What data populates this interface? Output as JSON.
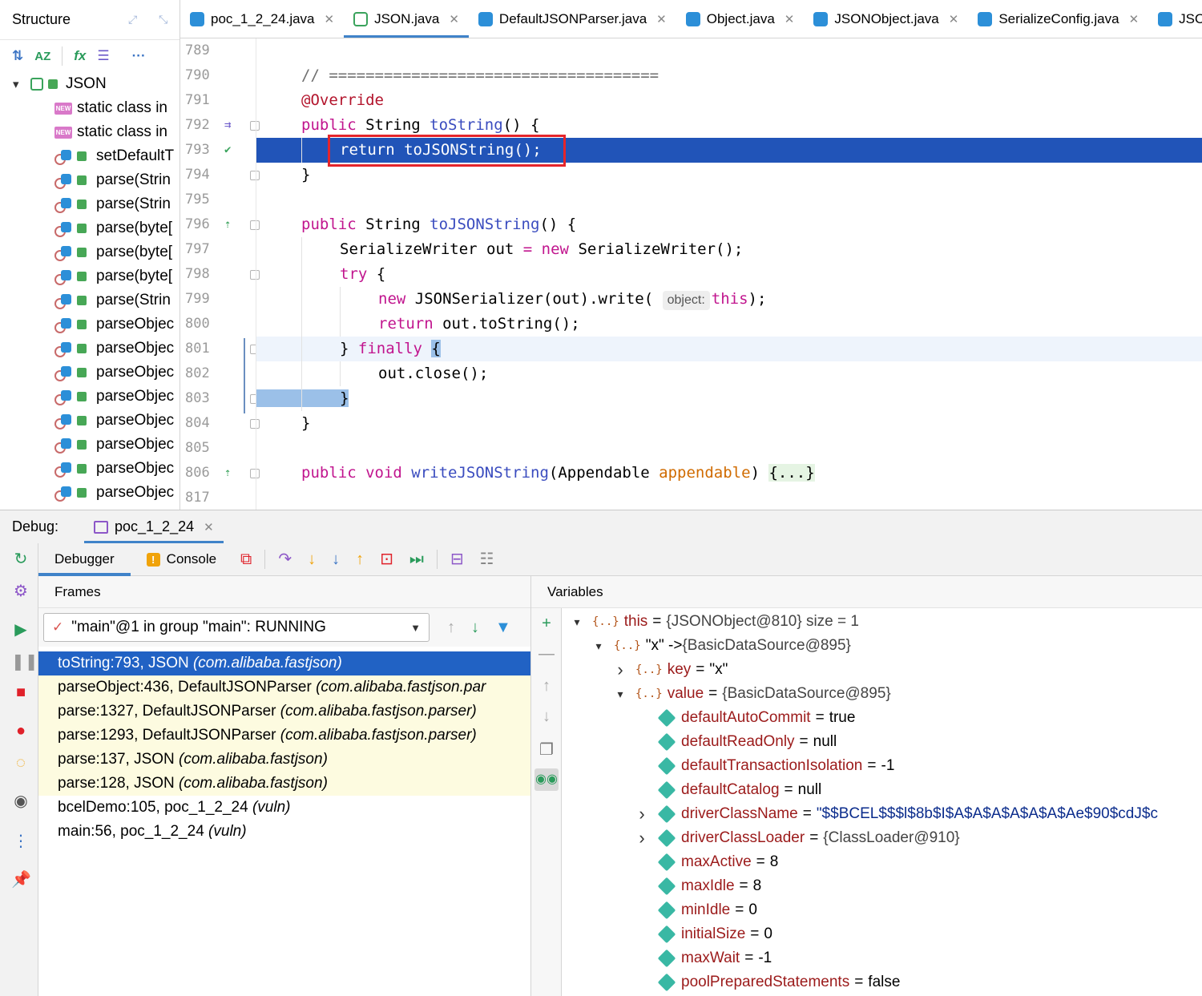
{
  "structure": {
    "title": "Structure",
    "root": "JSON",
    "items": [
      {
        "kind": "new",
        "label": "static class in"
      },
      {
        "kind": "new",
        "label": "static class in"
      },
      {
        "kind": "method",
        "label": "setDefaultT"
      },
      {
        "kind": "method",
        "label": "parse(Strin"
      },
      {
        "kind": "method",
        "label": "parse(Strin"
      },
      {
        "kind": "method",
        "label": "parse(byte["
      },
      {
        "kind": "method",
        "label": "parse(byte["
      },
      {
        "kind": "method",
        "label": "parse(byte["
      },
      {
        "kind": "method",
        "label": "parse(Strin"
      },
      {
        "kind": "method",
        "label": "parseObjec"
      },
      {
        "kind": "method",
        "label": "parseObjec"
      },
      {
        "kind": "method",
        "label": "parseObjec"
      },
      {
        "kind": "method",
        "label": "parseObjec"
      },
      {
        "kind": "method",
        "label": "parseObjec"
      },
      {
        "kind": "method",
        "label": "parseObjec"
      },
      {
        "kind": "method",
        "label": "parseObjec"
      },
      {
        "kind": "method",
        "label": "parseObjec"
      }
    ]
  },
  "tabs": [
    {
      "label": "poc_1_2_24.java",
      "icon": "class",
      "active": false
    },
    {
      "label": "JSON.java",
      "icon": "class-outline",
      "active": true
    },
    {
      "label": "DefaultJSONParser.java",
      "icon": "class",
      "active": false
    },
    {
      "label": "Object.java",
      "icon": "class",
      "active": false
    },
    {
      "label": "JSONObject.java",
      "icon": "class",
      "active": false
    },
    {
      "label": "SerializeConfig.java",
      "icon": "class",
      "active": false
    },
    {
      "label": "JSO",
      "icon": "class",
      "active": false
    }
  ],
  "editor": {
    "lines": [
      {
        "num": "789"
      },
      {
        "num": "790"
      },
      {
        "num": "791"
      },
      {
        "num": "792"
      },
      {
        "num": "793"
      },
      {
        "num": "794"
      },
      {
        "num": "795"
      },
      {
        "num": "796"
      },
      {
        "num": "797"
      },
      {
        "num": "798"
      },
      {
        "num": "799"
      },
      {
        "num": "800"
      },
      {
        "num": "801"
      },
      {
        "num": "802"
      },
      {
        "num": "803"
      },
      {
        "num": "804"
      },
      {
        "num": "805"
      },
      {
        "num": "806"
      },
      {
        "num": "817"
      }
    ],
    "code": {
      "l790_comment": "// ====================================",
      "l791_annotation": "@Override",
      "l792_kw": "public",
      "l792_type": " String ",
      "l792_fn": "toString",
      "l792_rest": "() {",
      "l793": "return toJSONString();",
      "l794": "}",
      "l796_kw": "public",
      "l796_type": " String ",
      "l796_fn": "toJSONString",
      "l796_rest": "() {",
      "l797_a": "SerializeWriter out ",
      "l797_eq": "=",
      "l797_new": " new",
      "l797_b": " SerializeWriter();",
      "l798_kw": "try",
      "l798_rest": " {",
      "l799_new": "new",
      "l799_a": " JSONSerializer(out).write( ",
      "l799_hint": "object:",
      "l799_this": "this",
      "l799_end": ");",
      "l800_kw": "return",
      "l800_rest": " out.toString();",
      "l801_a": "} ",
      "l801_kw": "finally",
      "l801_brace": "{",
      "l802": "out.close();",
      "l803": "}",
      "l804": "}",
      "l806_kw": "public void",
      "l806_fn": "writeJSONString",
      "l806_a": "(Appendable ",
      "l806_par": "appendable",
      "l806_b": ") ",
      "l806_fold": "{...}"
    }
  },
  "debug": {
    "label": "Debug:",
    "session": "poc_1_2_24",
    "tabs": {
      "debugger": "Debugger",
      "console": "Console"
    },
    "frames_header": "Frames",
    "variables_header": "Variables",
    "thread": "\"main\"@1 in group \"main\": RUNNING",
    "frames": [
      {
        "method": "toString:793, JSON ",
        "pkg": "(com.alibaba.fastjson)",
        "style": "selected"
      },
      {
        "method": "parseObject:436, DefaultJSONParser ",
        "pkg": "(com.alibaba.fastjson.par",
        "style": "library"
      },
      {
        "method": "parse:1327, DefaultJSONParser ",
        "pkg": "(com.alibaba.fastjson.parser)",
        "style": "library"
      },
      {
        "method": "parse:1293, DefaultJSONParser ",
        "pkg": "(com.alibaba.fastjson.parser)",
        "style": "library"
      },
      {
        "method": "parse:137, JSON ",
        "pkg": "(com.alibaba.fastjson)",
        "style": "library"
      },
      {
        "method": "parse:128, JSON ",
        "pkg": "(com.alibaba.fastjson)",
        "style": "library"
      },
      {
        "method": "bcelDemo:105, poc_1_2_24 ",
        "pkg": "(vuln)",
        "style": "normal"
      },
      {
        "method": "main:56, poc_1_2_24 ",
        "pkg": "(vuln)",
        "style": "normal"
      }
    ],
    "variables": [
      {
        "indent": 0,
        "chev": "open",
        "icon": "obj",
        "name": "this",
        "val": "{JSONObject@810}  size = 1",
        "valstyle": "ref"
      },
      {
        "indent": 1,
        "chev": "open",
        "icon": "obj",
        "name": "\"x\" -> ",
        "val": "{BasicDataSource@895}",
        "valstyle": "ref",
        "namestyle": "blk"
      },
      {
        "indent": 2,
        "chev": "closed",
        "icon": "obj",
        "name": "key",
        "val": "\"x\"",
        "valstyle": "plain"
      },
      {
        "indent": 2,
        "chev": "open",
        "icon": "obj",
        "name": "value",
        "val": "{BasicDataSource@895}",
        "valstyle": "ref"
      },
      {
        "indent": 3,
        "chev": "none",
        "icon": "field",
        "name": "defaultAutoCommit",
        "val": "true",
        "valstyle": "plain"
      },
      {
        "indent": 3,
        "chev": "none",
        "icon": "field",
        "name": "defaultReadOnly",
        "val": "null",
        "valstyle": "plain"
      },
      {
        "indent": 3,
        "chev": "none",
        "icon": "field",
        "name": "defaultTransactionIsolation",
        "val": "-1",
        "valstyle": "plain"
      },
      {
        "indent": 3,
        "chev": "none",
        "icon": "field",
        "name": "defaultCatalog",
        "val": "null",
        "valstyle": "plain"
      },
      {
        "indent": 3,
        "chev": "closed",
        "icon": "field",
        "name": "driverClassName",
        "val": "\"$$BCEL$$$l$8b$I$A$A$A$A$A$A$Ae$90$cdJ$c",
        "valstyle": "str"
      },
      {
        "indent": 3,
        "chev": "closed",
        "icon": "field",
        "name": "driverClassLoader",
        "val": "{ClassLoader@910}",
        "valstyle": "ref"
      },
      {
        "indent": 3,
        "chev": "none",
        "icon": "field",
        "name": "maxActive",
        "val": "8",
        "valstyle": "plain"
      },
      {
        "indent": 3,
        "chev": "none",
        "icon": "field",
        "name": "maxIdle",
        "val": "8",
        "valstyle": "plain"
      },
      {
        "indent": 3,
        "chev": "none",
        "icon": "field",
        "name": "minIdle",
        "val": "0",
        "valstyle": "plain"
      },
      {
        "indent": 3,
        "chev": "none",
        "icon": "field",
        "name": "initialSize",
        "val": "0",
        "valstyle": "plain"
      },
      {
        "indent": 3,
        "chev": "none",
        "icon": "field",
        "name": "maxWait",
        "val": "-1",
        "valstyle": "plain"
      },
      {
        "indent": 3,
        "chev": "none",
        "icon": "field",
        "name": "poolPreparedStatements",
        "val": "false",
        "valstyle": "plain"
      }
    ]
  },
  "colors": {
    "exec_line": "#2154b8",
    "selected_frame": "#2162c4",
    "library_frame": "#fdfbe0",
    "highlight_box": "#e5252b",
    "keyword": "#c1158e",
    "tab_underline": "#4083c9"
  },
  "icons": {
    "expand": "expand-icon",
    "collapse": "collapse-icon",
    "sort": "sort-icon",
    "sort_alpha": "sort-alpha-icon",
    "fields": "show-fields-icon",
    "inherited": "inherited-icon",
    "more": "more-icon",
    "rerun": "rerun-icon",
    "settings": "settings-icon",
    "resume": "resume-icon",
    "pause": "pause-icon",
    "stop": "stop-icon",
    "breakpoints": "view-breakpoints-icon",
    "mute": "mute-breakpoints-icon",
    "camera": "camera-icon",
    "more_vertical": "more-vertical-icon",
    "pin": "pin-icon"
  }
}
